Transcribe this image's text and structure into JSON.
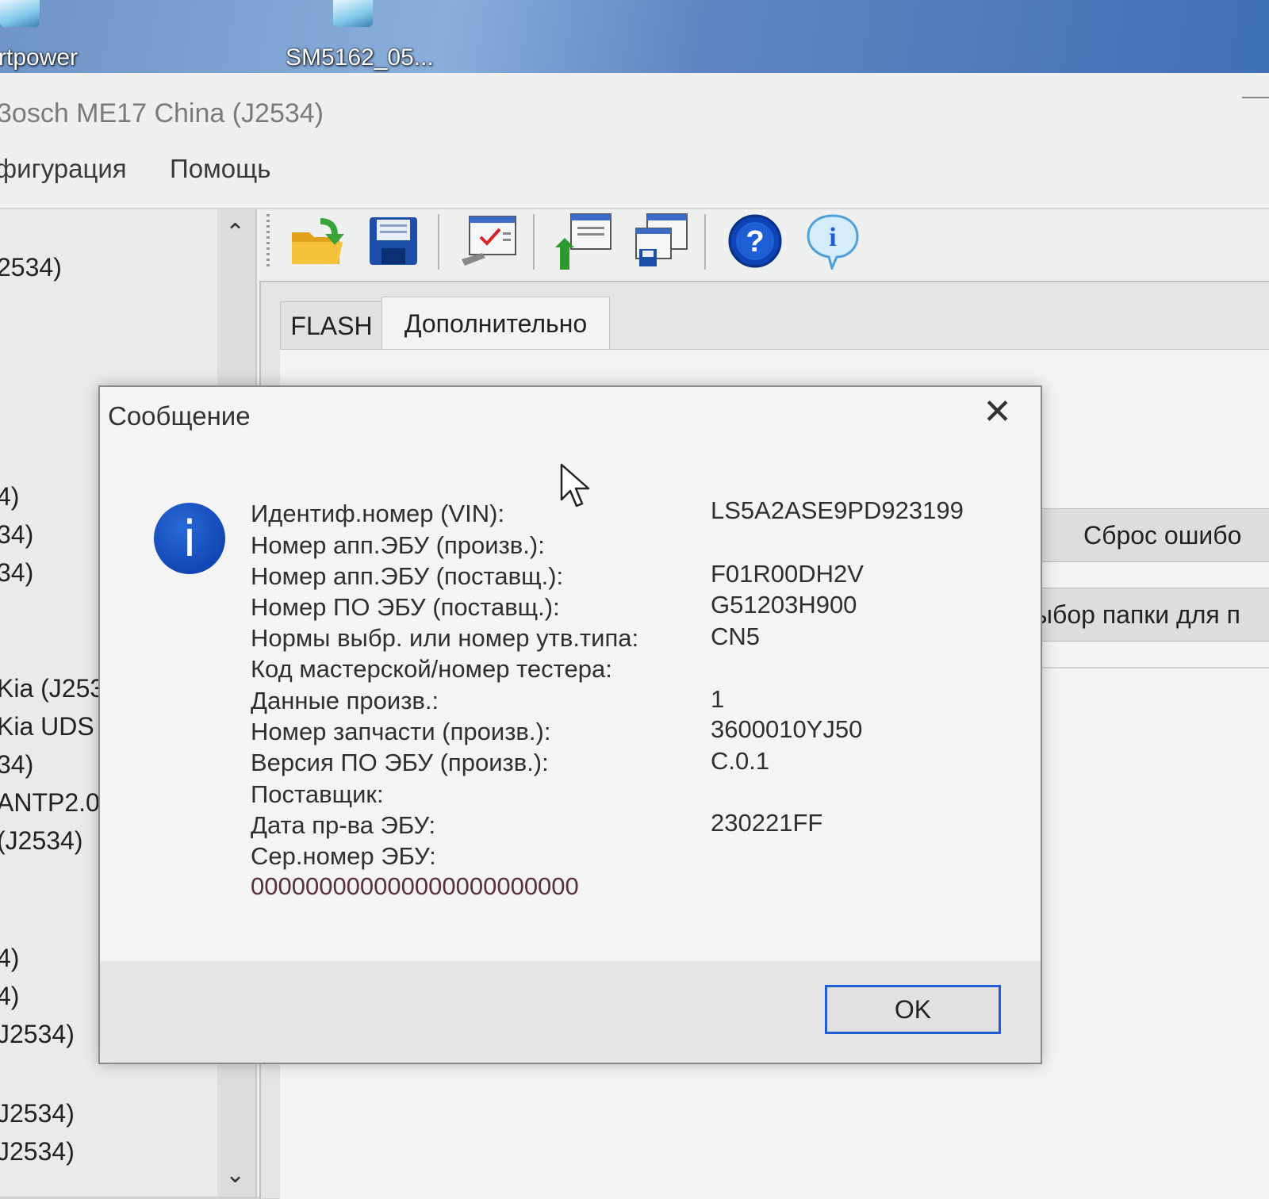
{
  "desktop": {
    "icons": [
      {
        "label": "rtpower",
        "icon": "application-icon"
      },
      {
        "label": "SM5162_05...",
        "icon": "application-icon"
      }
    ]
  },
  "window": {
    "title": "3osch ME17 China (J2534)"
  },
  "menu": {
    "items": [
      "фигурация",
      "Помощь"
    ]
  },
  "tree": {
    "items": [
      "2534)",
      "4)",
      "34)",
      "34)",
      "Kia (J253",
      "Kia UDS (",
      "34)",
      "ANTP2.0",
      "(J2534)",
      "4)",
      "4)",
      "J2534)",
      "J2534)",
      "J2534)"
    ]
  },
  "toolbar": {
    "buttons": [
      "open-folder-icon",
      "save-icon",
      "ecu-settings-icon",
      "read-ecu-icon",
      "write-ecu-icon",
      "help-icon",
      "info-icon"
    ]
  },
  "tabs": [
    {
      "label": "FLASH",
      "active": false
    },
    {
      "label": "Дополнительно",
      "active": true
    }
  ],
  "side_buttons": {
    "reset_errors": "Сброс ошибо",
    "choose_folder": "ыбор папки для п"
  },
  "dialog": {
    "title": "Сообщение",
    "close_glyph": "✕",
    "icon": "information-icon",
    "rows": [
      {
        "label": "Идентиф.номер (VIN):",
        "value": "LS5A2ASE9PD923199"
      },
      {
        "label": "Номер апп.ЭБУ (произв.):",
        "value": ""
      },
      {
        "label": "Номер апп.ЭБУ (поставщ.):",
        "value": "F01R00DH2V"
      },
      {
        "label": "Номер ПО ЭБУ (поставщ.):",
        "value": "G51203H900"
      },
      {
        "label": "Нормы выбр. или номер утв.типа:",
        "value": "CN5"
      },
      {
        "label": "Код мастерской/номер тестера:",
        "value": ""
      },
      {
        "label": "Данные произв.:",
        "value": "1"
      },
      {
        "label": "Номер запчасти (произв.):",
        "value": "3600010YJ50"
      },
      {
        "label": "Версия ПО ЭБУ (произв.):",
        "value": "C.0.1"
      },
      {
        "label": "Поставщик:",
        "value": ""
      },
      {
        "label": "Дата пр-ва ЭБУ:",
        "value": "230221FF"
      },
      {
        "label": "Сер.номер ЭБУ:",
        "value": ""
      }
    ],
    "serial": "000000000000000000000000",
    "ok_label": "OK"
  },
  "colors": {
    "accent": "#1f5fd1",
    "info_icon": "#1147b5"
  }
}
